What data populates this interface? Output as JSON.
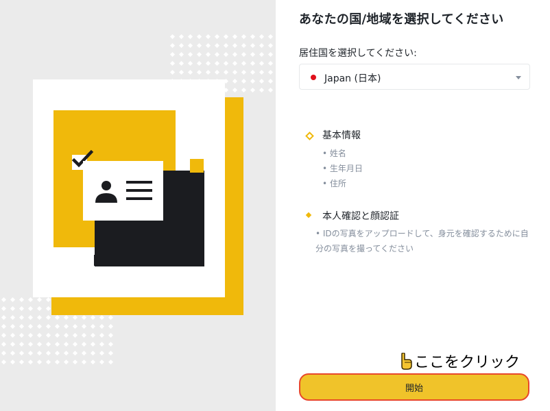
{
  "page": {
    "title": "あなたの国/地域を選択してください"
  },
  "residence": {
    "label": "居住国を選択してください:",
    "selected_country": "Japan (日本)",
    "flag_color": "#e0101b"
  },
  "sections": [
    {
      "heading": "基本情報",
      "items": [
        "• 姓名",
        "• 生年月日",
        "• 住所"
      ]
    },
    {
      "heading": "本人確認と顔認証",
      "items": [
        "• IDの写真をアップロードして、身元を確認するために自分の写真を撮ってください"
      ]
    }
  ],
  "hint": {
    "text": "ここをクリック",
    "icon": "pointing-hand-icon"
  },
  "actions": {
    "start_label": "開始"
  },
  "colors": {
    "accent": "#f0b90b",
    "button": "#f0c32a",
    "button_border": "#e8472b",
    "illustration_dark": "#1b1c20"
  }
}
